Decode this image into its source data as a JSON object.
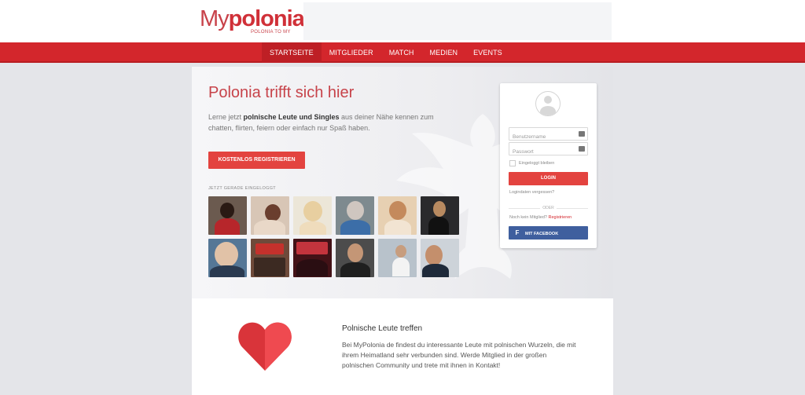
{
  "brand": {
    "logo_my": "My",
    "logo_polonia": "polonia",
    "tagline": "POLONIA TO MY"
  },
  "nav": {
    "items": [
      {
        "label": "STARTSEITE"
      },
      {
        "label": "MITGLIEDER"
      },
      {
        "label": "MATCH"
      },
      {
        "label": "MEDIEN"
      },
      {
        "label": "EVENTS"
      }
    ]
  },
  "hero": {
    "title": "Polonia trifft sich hier",
    "intro_pre": "Lerne jetzt ",
    "intro_bold": "polnische Leute und Singles",
    "intro_post": " aus deiner Nähe kennen zum chatten, flirten, feiern oder einfach nur Spaß haben.",
    "register_button": "KOSTENLOS REGISTRIEREN",
    "online_label": "JETZT GERADE EINGELOGGT"
  },
  "login": {
    "username_placeholder": "Benutzername",
    "password_placeholder": "Passwort",
    "remember_label": "Eingeloggt bleiben",
    "login_button": "LOGIN",
    "forgot_link": "Logindaten vergessen?",
    "or_label": "ODER",
    "no_member_text": "Noch kein Mitglied?",
    "register_link": "Registrieren",
    "facebook_button": "MIT FACEBOOK",
    "facebook_icon": "f"
  },
  "feature": {
    "title": "Polnische Leute treffen",
    "text": "Bei MyPolonia de findest du interessante Leute mit polnischen Wurzeln, die mit ihrem Heimatland sehr verbunden sind. Werde Mitglied in der großen polnischen Community und trete mit ihnen in Kontakt!"
  },
  "colors": {
    "brand_red": "#d3262c",
    "button_red": "#e3433f",
    "facebook_blue": "#3f5f9e"
  }
}
